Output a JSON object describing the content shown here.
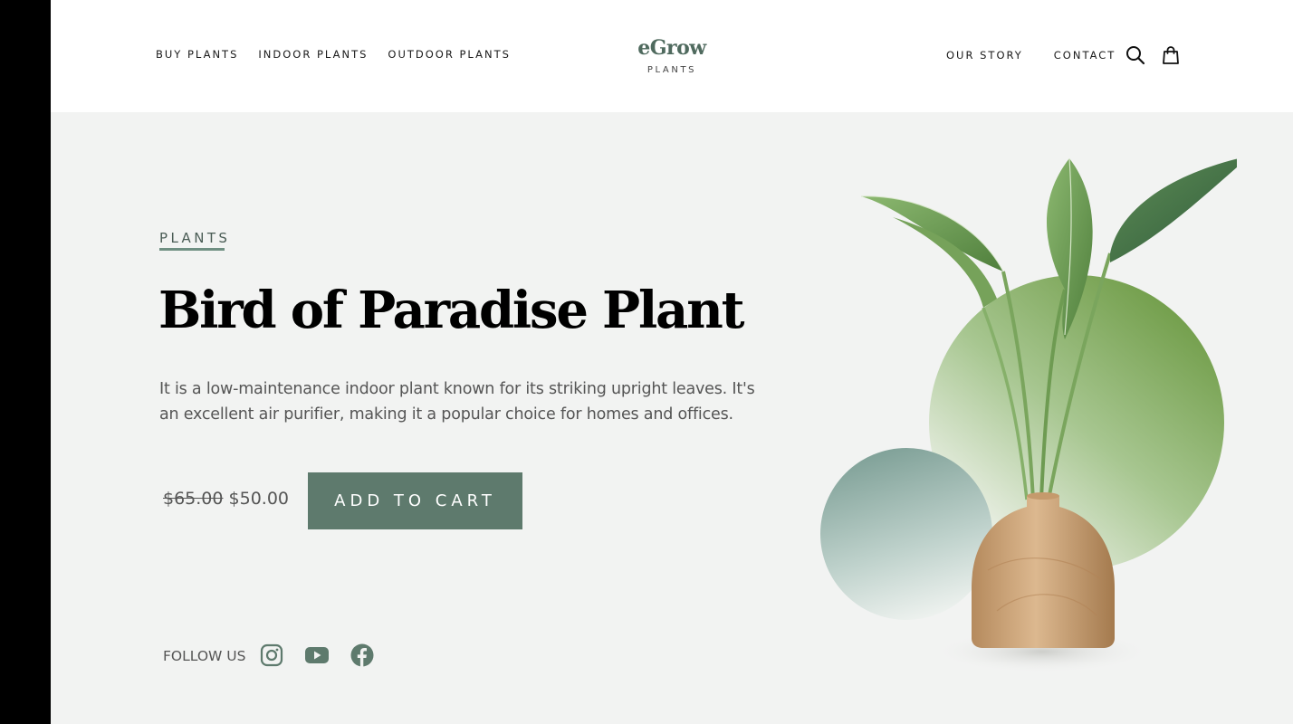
{
  "header": {
    "nav_left": [
      "BUY PLANTS",
      "INDOOR PLANTS",
      "OUTDOOR PLANTS"
    ],
    "logo_main": "eGrow",
    "logo_sub": "PLANTS",
    "nav_right": [
      "OUR STORY",
      "CONTACT"
    ],
    "icons": [
      "search-icon",
      "shopping-bag-icon"
    ]
  },
  "hero": {
    "category": "PLANTS",
    "title": "Bird of Paradise Plant",
    "description": "It is a low-maintenance indoor plant known for its striking upright leaves. It's an excellent air purifier, making it a popular choice for homes and offices.",
    "price_old": "$65.00",
    "price_new": "$50.00",
    "cta_label": "ADD TO CART"
  },
  "social": {
    "label": "FOLLOW US",
    "icons": [
      "instagram-icon",
      "youtube-icon",
      "facebook-icon"
    ]
  },
  "colors": {
    "accent": "#5e7a6d",
    "logo": "#4f6a5e",
    "background": "#f2f3f2",
    "circle_green": "#6f9b48",
    "circle_teal": "#7b9e97"
  }
}
